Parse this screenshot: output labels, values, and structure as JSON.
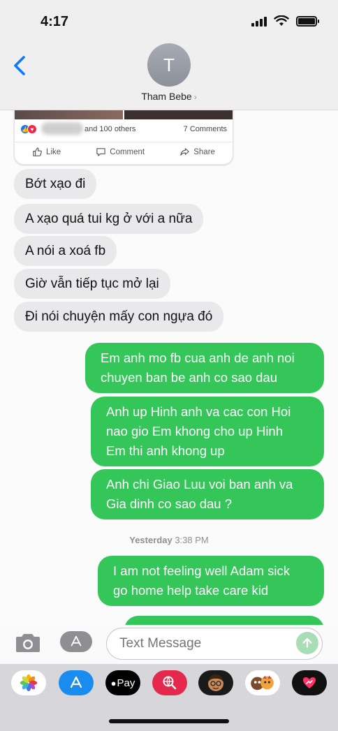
{
  "status_bar": {
    "time": "4:17"
  },
  "header": {
    "avatar_initial": "T",
    "contact_name": "Tham Bebe"
  },
  "shared_post": {
    "reactions_text": "and 100 others",
    "comments_text": "7 Comments",
    "actions": [
      {
        "label": "Like",
        "icon": "thumbs-up-icon"
      },
      {
        "label": "Comment",
        "icon": "comment-icon"
      },
      {
        "label": "Share",
        "icon": "share-icon"
      }
    ]
  },
  "messages": [
    {
      "direction": "in",
      "text": "Bớt xạo đi"
    },
    {
      "direction": "in",
      "text": "A xạo quá tui kg ở với a nữa"
    },
    {
      "direction": "in",
      "text": "A nói a xoá fb"
    },
    {
      "direction": "in",
      "text": "Giờ vẫn tiếp tục mở lại"
    },
    {
      "direction": "in",
      "text": "Đi nói chuyện mấy con ngựa đó"
    },
    {
      "direction": "out",
      "lines": [
        "Em anh mo fb cua anh de anh noi",
        "chuyen ban be anh co sao dau"
      ]
    },
    {
      "direction": "out",
      "lines": [
        "Anh up Hinh anh va cac con Hoi",
        "nao gio Em khong cho up Hinh",
        "Em thi anh khong up"
      ]
    },
    {
      "direction": "out",
      "lines": [
        "Anh chi Giao Luu voi ban anh va",
        "Gia dinh co sao dau ?"
      ]
    },
    {
      "direction": "out",
      "lines": [
        "I am not feeling well Adam sick",
        "go home help take care kid"
      ]
    }
  ],
  "timestamp": {
    "day": "Yesterday",
    "time": "3:38 PM"
  },
  "input": {
    "placeholder": "Text Message"
  },
  "drawer": {
    "apps": [
      {
        "name": "photos-app-icon"
      },
      {
        "name": "app-store-icon"
      },
      {
        "name": "apple-pay-icon",
        "label": "Pay"
      },
      {
        "name": "image-search-icon"
      },
      {
        "name": "memoji-icon"
      },
      {
        "name": "animoji-icon"
      },
      {
        "name": "digital-touch-icon"
      }
    ]
  },
  "colors": {
    "sent_bubble": "#34c659",
    "received_bubble": "#e9e9eb",
    "ios_blue": "#0a7aff"
  }
}
